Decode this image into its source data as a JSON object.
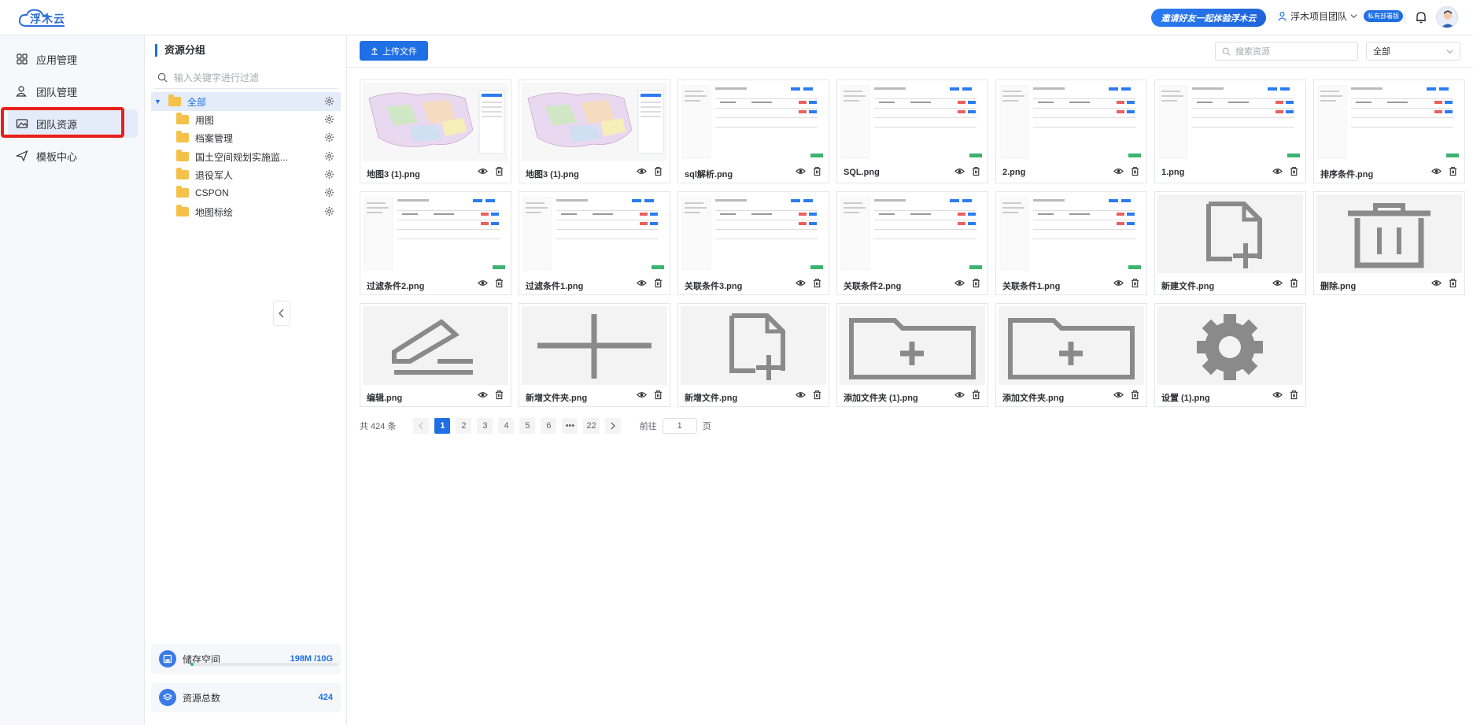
{
  "header": {
    "logo_text": "浮木云",
    "invite_label": "邀请好友一起体验浮木云",
    "team_name": "浮木项目团队",
    "team_badge": "私有部署版"
  },
  "sidebar": {
    "items": [
      {
        "label": "应用管理",
        "icon": "grid-icon"
      },
      {
        "label": "团队管理",
        "icon": "users-icon"
      },
      {
        "label": "团队资源",
        "icon": "image-folder-icon",
        "active": true
      },
      {
        "label": "模板中心",
        "icon": "send-icon"
      }
    ]
  },
  "group_panel": {
    "title": "资源分组",
    "filter_placeholder": "输入关键字进行过滤",
    "tree": [
      {
        "label": "全部",
        "root": true
      },
      {
        "label": "用图"
      },
      {
        "label": "档案管理"
      },
      {
        "label": "国土空间规划实施监..."
      },
      {
        "label": "退役军人"
      },
      {
        "label": "CSPON"
      },
      {
        "label": "地图标绘"
      }
    ],
    "storage_label": "储存空间",
    "storage_value": "198M /10G",
    "storage_fraction": 0.02,
    "total_label": "资源总数",
    "total_value": "424"
  },
  "main": {
    "upload_label": "上传文件",
    "search_placeholder": "搜索资源",
    "filter_value": "全部",
    "files": [
      {
        "name": "地图3 (1).png",
        "thumb": "map"
      },
      {
        "name": "地图3 (1).png",
        "thumb": "map"
      },
      {
        "name": "sql解析.png",
        "thumb": "shot"
      },
      {
        "name": "SQL.png",
        "thumb": "shot"
      },
      {
        "name": "2.png",
        "thumb": "shot"
      },
      {
        "name": "1.png",
        "thumb": "shot"
      },
      {
        "name": "排序条件.png",
        "thumb": "shot"
      },
      {
        "name": "过滤条件2.png",
        "thumb": "shot"
      },
      {
        "name": "过滤条件1.png",
        "thumb": "shot"
      },
      {
        "name": "关联条件3.png",
        "thumb": "shot"
      },
      {
        "name": "关联条件2.png",
        "thumb": "shot"
      },
      {
        "name": "关联条件1.png",
        "thumb": "shot"
      },
      {
        "name": "新建文件.png",
        "thumb": "new-file-icon"
      },
      {
        "name": "删除.png",
        "thumb": "trash-icon"
      },
      {
        "name": "编辑.png",
        "thumb": "edit-icon"
      },
      {
        "name": "新增文件夹.png",
        "thumb": "plus-icon"
      },
      {
        "name": "新增文件.png",
        "thumb": "new-file-icon"
      },
      {
        "name": "添加文件夹 (1).png",
        "thumb": "folder-plus-icon"
      },
      {
        "name": "添加文件夹.png",
        "thumb": "folder-plus-icon"
      },
      {
        "name": "设置 (1).png",
        "thumb": "gear-icon"
      }
    ]
  },
  "pagination": {
    "total_text": "共 424 条",
    "pages": [
      "1",
      "2",
      "3",
      "4",
      "5",
      "6",
      "•••",
      "22"
    ],
    "current": "1",
    "goto_label": "前往",
    "goto_value": "1",
    "page_suffix": "页"
  },
  "colors": {
    "accent": "#1f6fe5",
    "highlight": "#e8201b",
    "folder": "#f5c14a"
  }
}
